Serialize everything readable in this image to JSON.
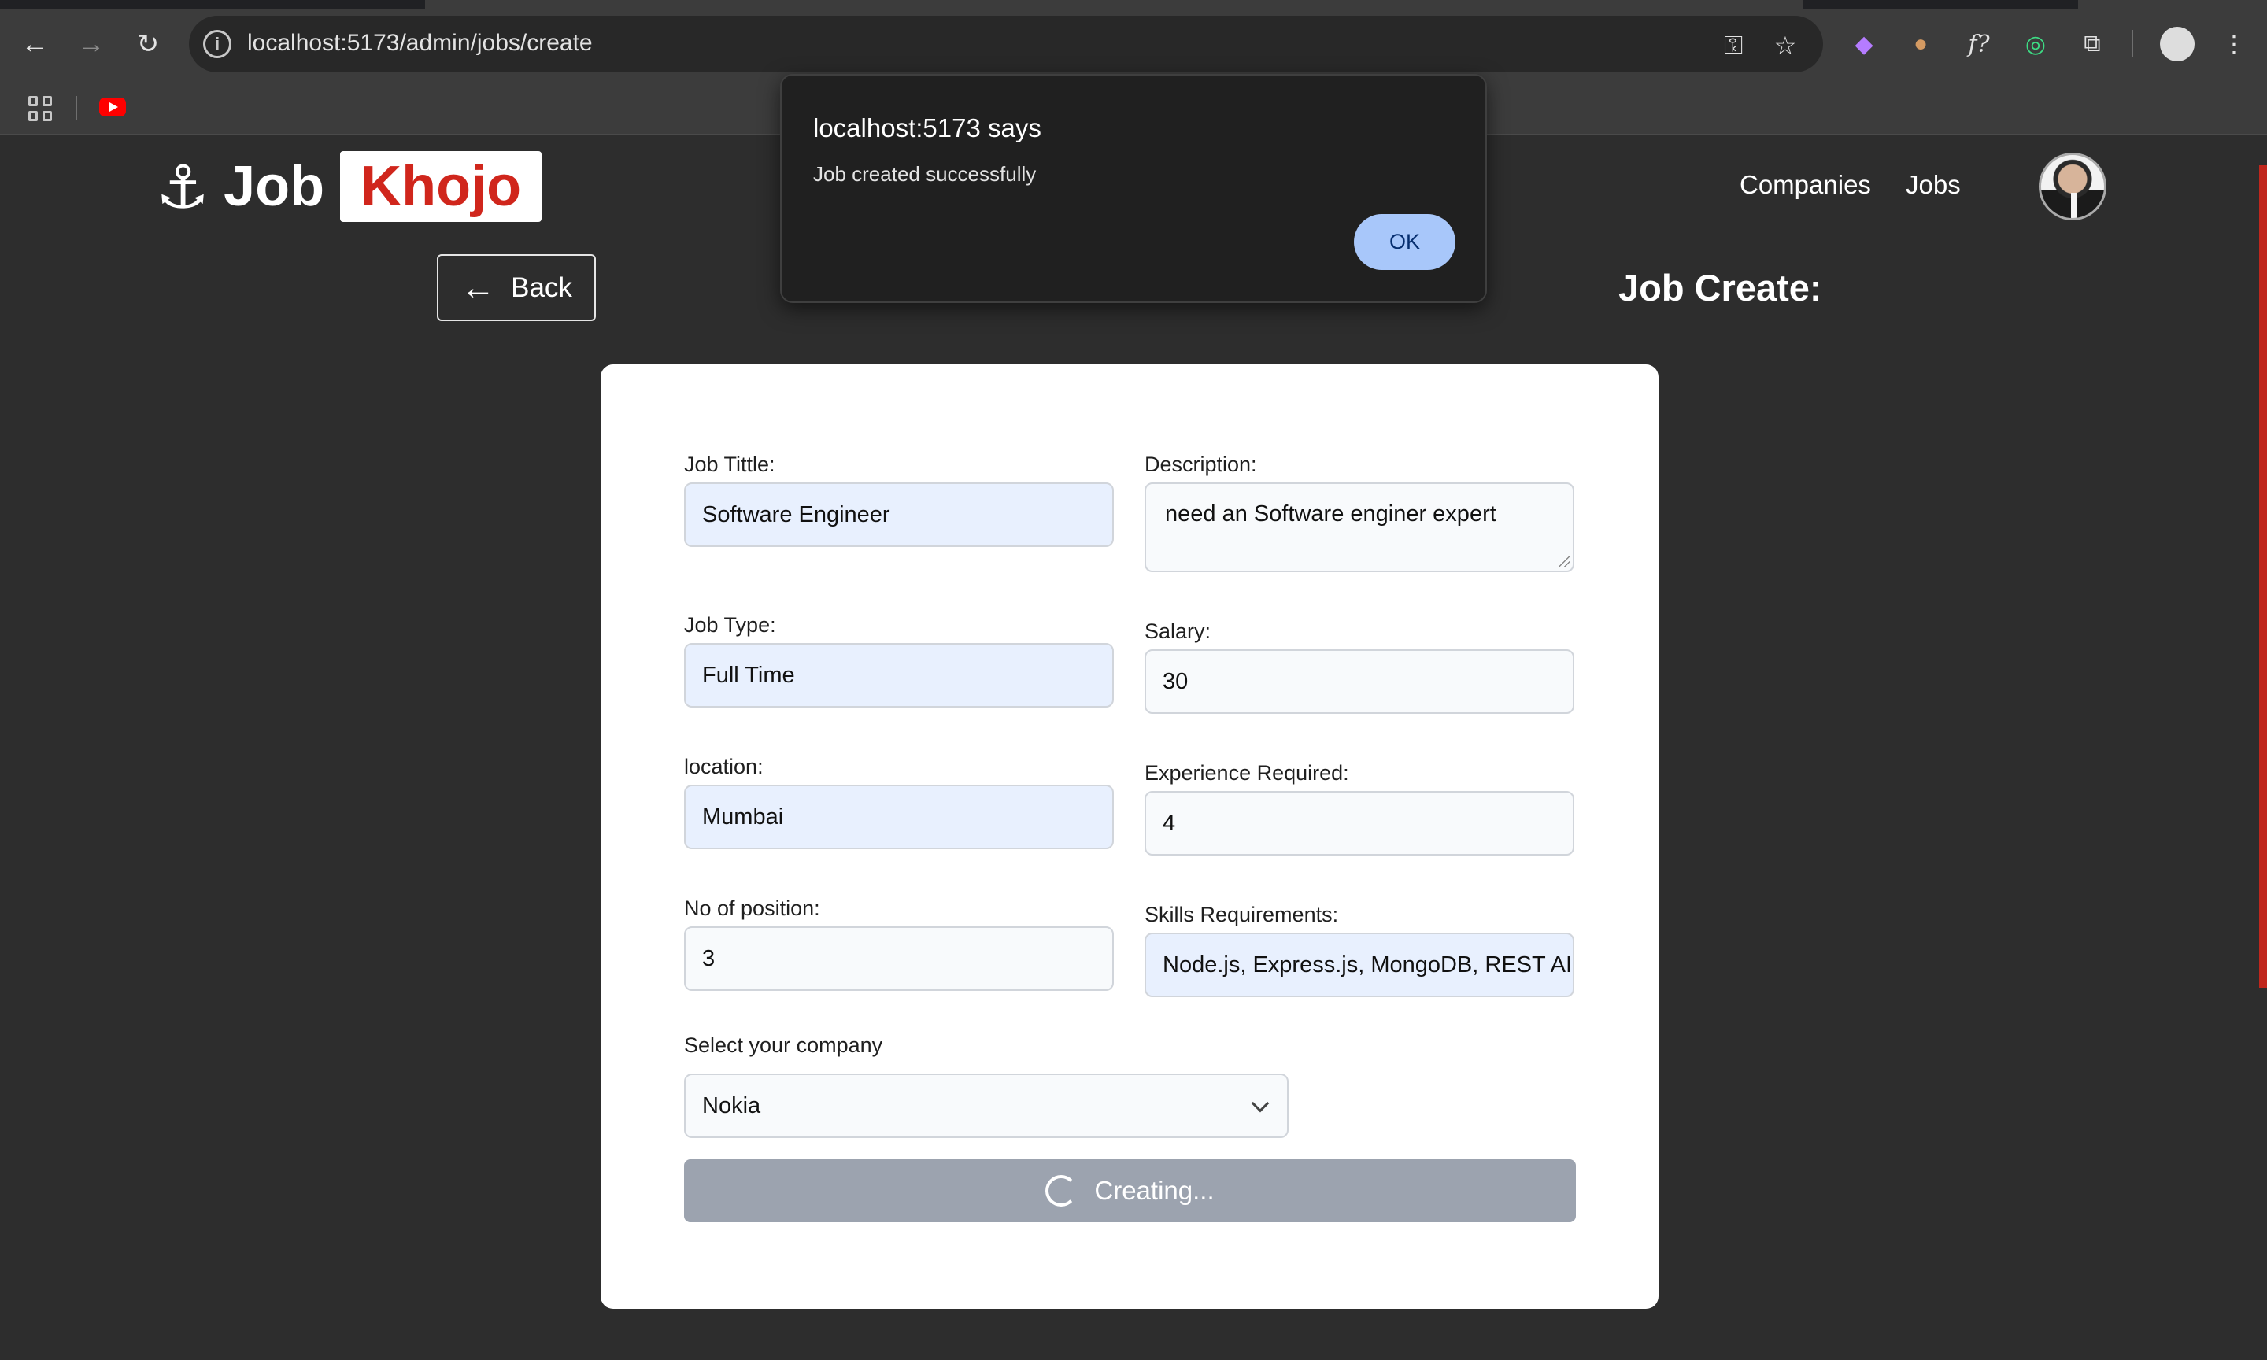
{
  "browser": {
    "url": "localhost:5173/admin/jobs/create",
    "icons": {
      "back": "back-arrow-icon",
      "forward": "forward-arrow-icon",
      "reload": "reload-icon",
      "info": "site-info-icon",
      "password": "key-icon",
      "bookmark": "star-icon",
      "menu": "kebab-menu-icon"
    }
  },
  "brand": {
    "anchor": "⚓",
    "job": "Job",
    "khojo": "Khojo",
    "accent_color": "#d0261c"
  },
  "nav": {
    "companies": "Companies",
    "jobs": "Jobs"
  },
  "back_button": {
    "arrow": "←",
    "label": "Back"
  },
  "heading": "Job Create:",
  "form": {
    "job_title": {
      "label": "Job Tittle:",
      "value": "Software Engineer"
    },
    "description": {
      "label": "Description:",
      "value": "need an Software enginer expert"
    },
    "job_type": {
      "label": "Job Type:",
      "value": "Full Time"
    },
    "salary": {
      "label": "Salary:",
      "value": "30"
    },
    "location": {
      "label": "location:",
      "value": "Mumbai"
    },
    "experience": {
      "label": "Experience Required:",
      "value": "4"
    },
    "positions": {
      "label": "No of position:",
      "value": "3"
    },
    "skills": {
      "label": "Skills Requirements:",
      "value": "Node.js, Express.js, MongoDB, REST AI"
    },
    "company": {
      "label": "Select your company",
      "value": "Nokia"
    },
    "submit": "Creating..."
  },
  "alert": {
    "title": "localhost:5173 says",
    "message": "Job created successfully",
    "ok": "OK"
  }
}
